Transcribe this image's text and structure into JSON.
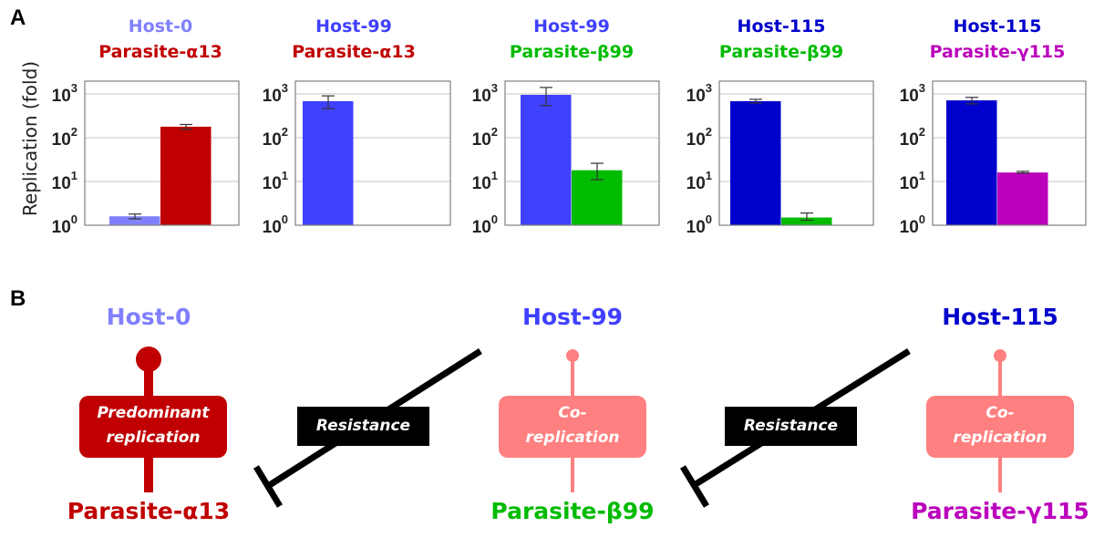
{
  "panel_a": {
    "letter": "A",
    "ylabel": "Replication (fold)"
  },
  "panel_b": {
    "letter": "B",
    "hosts": [
      {
        "label": "Host-0",
        "color": "#8080ff"
      },
      {
        "label": "Host-99",
        "color": "#4040ff"
      },
      {
        "label": "Host-115",
        "color": "#0000cc"
      }
    ],
    "parasites": [
      {
        "label": "Parasite-α13",
        "color": "#c00000"
      },
      {
        "label": "Parasite-β99",
        "color": "#00bb00"
      },
      {
        "label": "Parasite-γ115",
        "color": "#bb00bb"
      }
    ],
    "interactions": [
      {
        "line1": "Predominant",
        "line2": "replication",
        "color": "#c00000"
      },
      {
        "line1": "Co-",
        "line2": "replication",
        "color": "#ff8080"
      },
      {
        "line1": "Co-",
        "line2": "replication",
        "color": "#ff8080"
      }
    ],
    "inhibitions": [
      {
        "label": "Resistance"
      },
      {
        "label": "Resistance"
      }
    ]
  },
  "chart_data": [
    {
      "type": "bar",
      "title": [
        "Host-0",
        "Parasite-α13"
      ],
      "title_colors": [
        "#8080ff",
        "#c00000"
      ],
      "xlabel": "",
      "ylabel": "Replication (fold)",
      "yscale": "log",
      "ylim": [
        1,
        1950
      ],
      "yticks": [
        1,
        10,
        100,
        1000
      ],
      "ytick_labels": [
        {
          "base": "10",
          "exp": "0"
        },
        {
          "base": "10",
          "exp": "1"
        },
        {
          "base": "10",
          "exp": "2"
        },
        {
          "base": "10",
          "exp": "3"
        }
      ],
      "grid": true,
      "series": [
        {
          "name": "Host-0",
          "value": 1.6,
          "err_low": 1.4,
          "err_high": 1.8,
          "color": "#8080ff"
        },
        {
          "name": "Parasite-α13",
          "value": 178,
          "err_low": 155,
          "err_high": 200,
          "color": "#c00000"
        }
      ]
    },
    {
      "type": "bar",
      "title": [
        "Host-99",
        "Parasite-α13"
      ],
      "title_colors": [
        "#4040ff",
        "#c00000"
      ],
      "xlabel": "",
      "ylabel": "",
      "yscale": "log",
      "ylim": [
        1,
        1950
      ],
      "yticks": [
        1,
        10,
        100,
        1000
      ],
      "ytick_labels": [
        {
          "base": "10",
          "exp": "0"
        },
        {
          "base": "10",
          "exp": "1"
        },
        {
          "base": "10",
          "exp": "2"
        },
        {
          "base": "10",
          "exp": "3"
        }
      ],
      "grid": true,
      "series": [
        {
          "name": "Host-99",
          "value": 680,
          "err_low": 460,
          "err_high": 900,
          "color": "#4040ff"
        },
        {
          "name": "Parasite-α13",
          "value": null,
          "err_low": null,
          "err_high": null,
          "color": "#c00000"
        }
      ]
    },
    {
      "type": "bar",
      "title": [
        "Host-99",
        "Parasite-β99"
      ],
      "title_colors": [
        "#4040ff",
        "#00bb00"
      ],
      "xlabel": "",
      "ylabel": "",
      "yscale": "log",
      "ylim": [
        1,
        1950
      ],
      "yticks": [
        1,
        10,
        100,
        1000
      ],
      "ytick_labels": [
        {
          "base": "10",
          "exp": "0"
        },
        {
          "base": "10",
          "exp": "1"
        },
        {
          "base": "10",
          "exp": "2"
        },
        {
          "base": "10",
          "exp": "3"
        }
      ],
      "grid": true,
      "series": [
        {
          "name": "Host-99",
          "value": 950,
          "err_low": 540,
          "err_high": 1400,
          "color": "#4040ff"
        },
        {
          "name": "Parasite-β99",
          "value": 18,
          "err_low": 11,
          "err_high": 26,
          "color": "#00bb00"
        }
      ]
    },
    {
      "type": "bar",
      "title": [
        "Host-115",
        "Parasite-β99"
      ],
      "title_colors": [
        "#0000cc",
        "#00bb00"
      ],
      "xlabel": "",
      "ylabel": "",
      "yscale": "log",
      "ylim": [
        1,
        1950
      ],
      "yticks": [
        1,
        10,
        100,
        1000
      ],
      "ytick_labels": [
        {
          "base": "10",
          "exp": "0"
        },
        {
          "base": "10",
          "exp": "1"
        },
        {
          "base": "10",
          "exp": "2"
        },
        {
          "base": "10",
          "exp": "3"
        }
      ],
      "grid": true,
      "series": [
        {
          "name": "Host-115",
          "value": 680,
          "err_low": 620,
          "err_high": 750,
          "color": "#0000cc"
        },
        {
          "name": "Parasite-β99",
          "value": 1.5,
          "err_low": 1.3,
          "err_high": 1.9,
          "color": "#00bb00"
        }
      ]
    },
    {
      "type": "bar",
      "title": [
        "Host-115",
        "Parasite-γ115"
      ],
      "title_colors": [
        "#0000cc",
        "#bb00bb"
      ],
      "xlabel": "",
      "ylabel": "",
      "yscale": "log",
      "ylim": [
        1,
        1950
      ],
      "yticks": [
        1,
        10,
        100,
        1000
      ],
      "ytick_labels": [
        {
          "base": "10",
          "exp": "0"
        },
        {
          "base": "10",
          "exp": "1"
        },
        {
          "base": "10",
          "exp": "2"
        },
        {
          "base": "10",
          "exp": "3"
        }
      ],
      "grid": true,
      "series": [
        {
          "name": "Host-115",
          "value": 710,
          "err_low": 590,
          "err_high": 830,
          "color": "#0000cc"
        },
        {
          "name": "Parasite-γ115",
          "value": 16,
          "err_low": 15.5,
          "err_high": 17,
          "color": "#bb00bb"
        }
      ]
    }
  ]
}
